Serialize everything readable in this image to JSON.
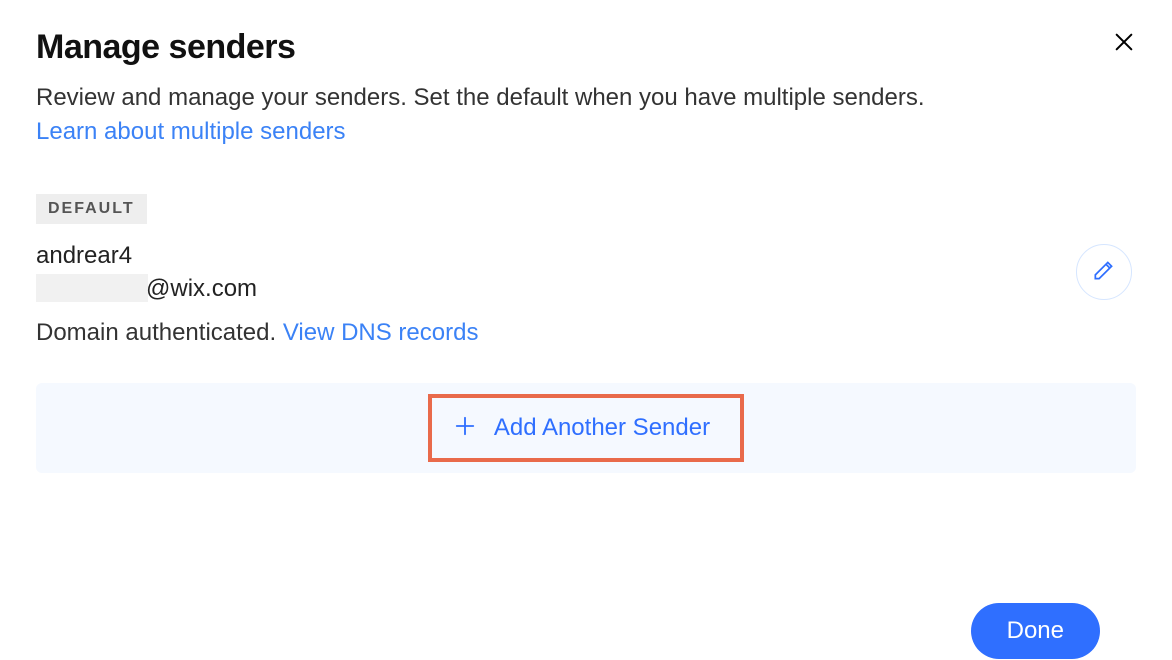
{
  "dialog": {
    "title": "Manage senders",
    "subtitle_prefix": "Review and manage your senders. Set the default when you have multiple senders. ",
    "learn_link": "Learn about multiple senders"
  },
  "sender": {
    "default_badge": "DEFAULT",
    "name": "andrear4",
    "email_domain": "@wix.com",
    "domain_status_prefix": "Domain authenticated. ",
    "view_dns_link": "View DNS records"
  },
  "actions": {
    "add_another": "Add Another Sender",
    "done": "Done"
  }
}
